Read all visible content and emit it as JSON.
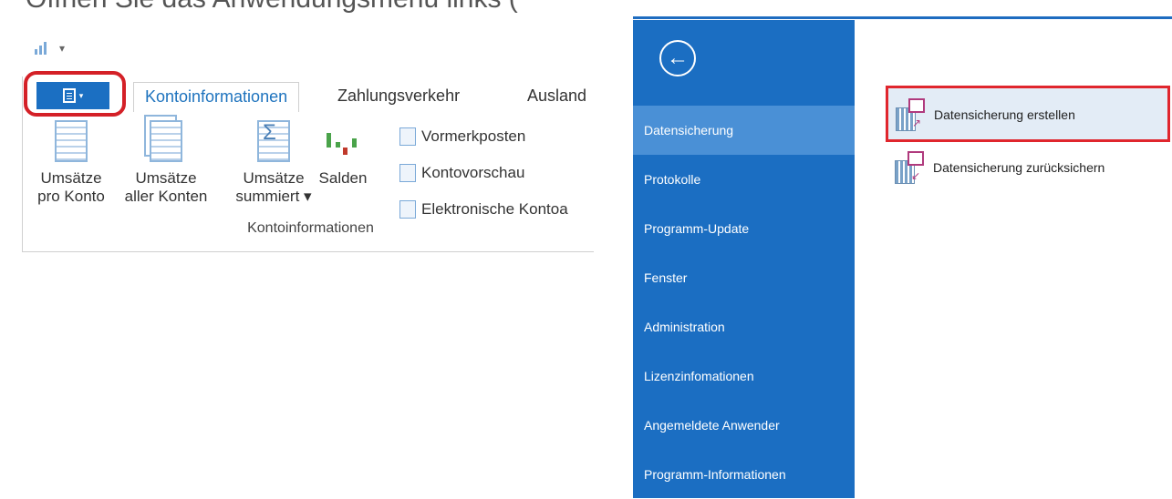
{
  "left": {
    "cut_heading": "Öffnen Sie das Anwendungsmenü links (",
    "tabs": [
      "Kontoinformationen",
      "Zahlungsverkehr",
      "Ausland"
    ],
    "big_buttons": [
      {
        "line1": "Umsätze",
        "line2": "pro Konto"
      },
      {
        "line1": "Umsätze",
        "line2": "aller Konten"
      },
      {
        "line1": "Umsätze",
        "line2": "summiert ▾"
      },
      {
        "line1": "Salden",
        "line2": ""
      }
    ],
    "small_buttons": [
      "Vormerkposten",
      "Kontovorschau",
      "Elektronische Kontoa"
    ],
    "group_label": "Kontoinformationen"
  },
  "backstage": {
    "back_glyph": "←",
    "nav": [
      "Datensicherung",
      "Protokolle",
      "Programm-Update",
      "Fenster",
      "Administration",
      "Lizenzinfomationen",
      "Angemeldete Anwender",
      "Programm-Informationen"
    ],
    "selected_nav": "Datensicherung",
    "actions": [
      "Datensicherung erstellen",
      "Datensicherung zurücksichern"
    ]
  },
  "colors": {
    "accent": "#1b6ec2",
    "highlight_red": "#e0262d",
    "selected_nav": "#4a90d6"
  }
}
